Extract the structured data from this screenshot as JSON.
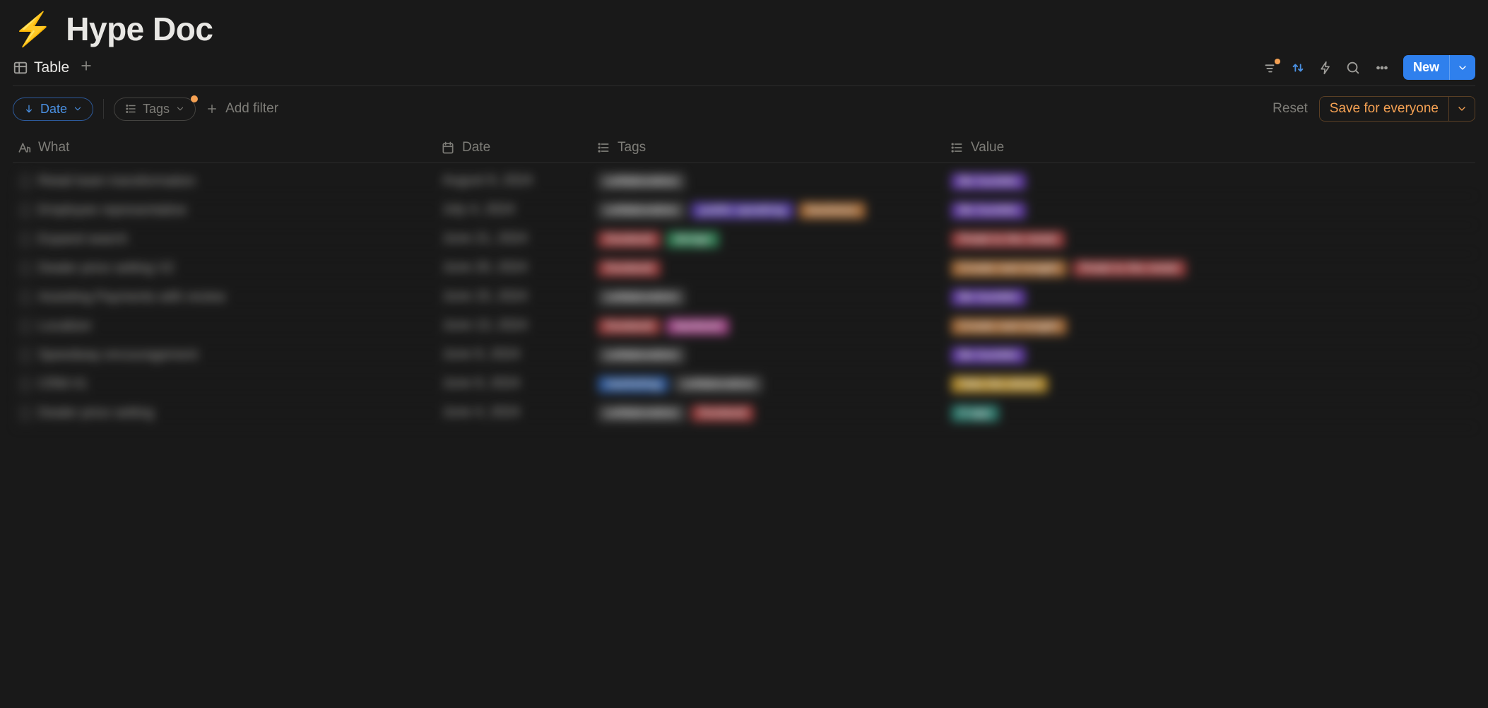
{
  "title": {
    "emoji": "⚡",
    "text": "Hype Doc"
  },
  "tabs": {
    "active": "Table"
  },
  "toolbar": {
    "new_label": "New"
  },
  "filters": {
    "sort_pill": "Date",
    "tags_pill": "Tags",
    "add_filter": "Add filter",
    "reset": "Reset",
    "save": "Save for everyone"
  },
  "columns": {
    "what": "What",
    "date": "Date",
    "tags": "Tags",
    "value": "Value"
  },
  "rows": [
    {
      "what": "Retail team transformation",
      "date": "August 9, 2024",
      "tags": [
        {
          "t": "collaboration",
          "c": "gray"
        }
      ],
      "value": [
        {
          "t": "Be humble",
          "c": "purple"
        }
      ]
    },
    {
      "what": "Employee representative",
      "date": "July 4, 2024",
      "tags": [
        {
          "t": "collaboration",
          "c": "gray"
        },
        {
          "t": "public speaking",
          "c": "indigo"
        },
        {
          "t": "business",
          "c": "orange"
        }
      ],
      "value": [
        {
          "t": "Be humble",
          "c": "purple"
        }
      ]
    },
    {
      "what": "Expand search",
      "date": "June 21, 2024",
      "tags": [
        {
          "t": "frontend",
          "c": "red"
        },
        {
          "t": "design",
          "c": "green"
        }
      ],
      "value": [
        {
          "t": "Pedal to the metal",
          "c": "red"
        }
      ]
    },
    {
      "what": "Dealer price setting V2",
      "date": "June 20, 2024",
      "tags": [
        {
          "t": "frontend",
          "c": "red"
        }
      ],
      "value": [
        {
          "t": "Create real insight",
          "c": "orange"
        },
        {
          "t": "Pedal to the metal",
          "c": "red"
        }
      ]
    },
    {
      "what": "Assisting Payments with review",
      "date": "June 15, 2024",
      "tags": [
        {
          "t": "collaboration",
          "c": "gray"
        }
      ],
      "value": [
        {
          "t": "Be humble",
          "c": "purple"
        }
      ]
    },
    {
      "what": "Localizer",
      "date": "June 13, 2024",
      "tags": [
        {
          "t": "frontend",
          "c": "red"
        },
        {
          "t": "backend",
          "c": "pink"
        }
      ],
      "value": [
        {
          "t": "Create real insight",
          "c": "orange"
        }
      ]
    },
    {
      "what": "Speedway encouragement",
      "date": "June 9, 2024",
      "tags": [
        {
          "t": "collaboration",
          "c": "gray"
        }
      ],
      "value": [
        {
          "t": "Be humble",
          "c": "purple"
        }
      ]
    },
    {
      "what": "CRM #1",
      "date": "June 9, 2024",
      "tags": [
        {
          "t": "marketing",
          "c": "blue"
        },
        {
          "t": "collaboration",
          "c": "gray"
        }
      ],
      "value": [
        {
          "t": "Take the wheel",
          "c": "yellow"
        }
      ]
    },
    {
      "what": "Dealer price setting",
      "date": "June 4, 2024",
      "tags": [
        {
          "t": "collaboration",
          "c": "gray"
        },
        {
          "t": "frontend",
          "c": "red"
        }
      ],
      "value": [
        {
          "t": "X app",
          "c": "teal"
        }
      ]
    }
  ]
}
